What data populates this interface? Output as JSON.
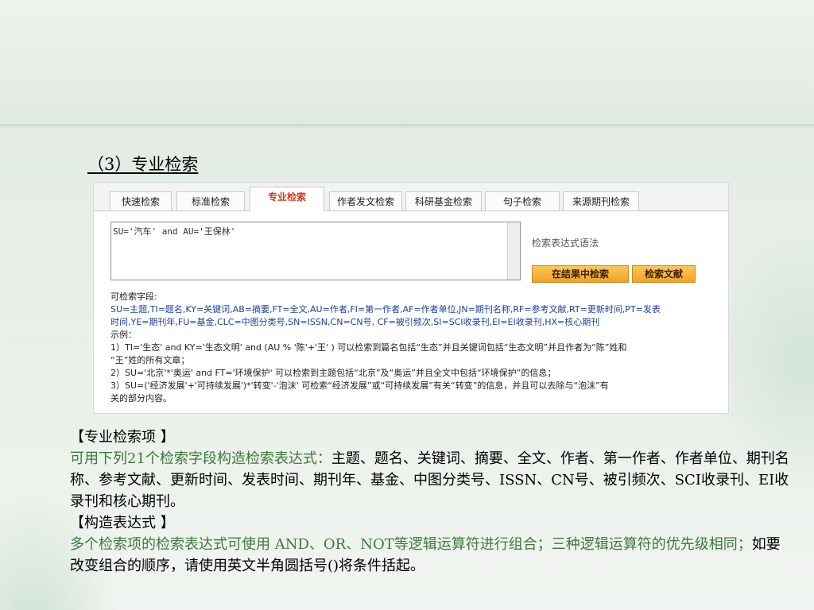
{
  "section_title": "（3）专业检索",
  "tabs": [
    "快速检索",
    "标准检索",
    "专业检索",
    "作者发文检索",
    "科研基金检索",
    "句子检索",
    "来源期刊检索"
  ],
  "expression_value": "SU='汽车' and AU='王保林'",
  "syntax_link": "检索表达式语法",
  "buttons": {
    "search_in_results": "在结果中检索",
    "search_documents": "检索文献"
  },
  "fields": {
    "label": "可检索字段:",
    "line1": "SU=主题,TI=题名,KY=关键词,AB=摘要,FT=全文,AU=作者,FI=第一作者,AF=作者单位,JN=期刊名称,RF=参考文献,RT=更新时间,PT=发表",
    "line2": "时间,YE=期刊年,FU=基金,CLC=中图分类号,SN=ISSN,CN=CN号, CF=被引频次,SI=SCI收录刊,EI=EI收录刊,HX=核心期刊",
    "examples_label": "示例：",
    "ex1a": "1）TI='生态' and KY='生态文明' and (AU % '陈'+'王' ) 可以检索到篇名包括“生态”并且关键词包括“生态文明”并且作者为“陈”姓和",
    "ex1b": "“王”姓的所有文章；",
    "ex2": "2）SU='北京'*'奥运' and FT='环境保护' 可以检索到主题包括“北京”及“奥运”并且全文中包括“环境保护”的信息；",
    "ex3a": "3）SU=('经济发展'+'可持续发展')*'转变'-'泡沫' 可检索“经济发展”或“可持续发展”有关“转变”的信息，并且可以去除与“泡沫”有",
    "ex3b": "关的部分内容。"
  },
  "notes": {
    "heading1": "【专业检索项 】",
    "para1_green": "可用下列21个检索字段构造检索表达式：",
    "para1_rest": "主题、题名、关键词、摘要、全文、作者、第一作者、作者单位、期刊名称、参考文献、更新时间、发表时间、期刊年、基金、中图分类号、ISSN、CN号、被引频次、SCI收录刊、EI收录刊和核心期刊。",
    "heading2": "【构造表达式 】",
    "para2_green": "多个检索项的检索表达式可使用 AND、OR、NOT等逻辑运算符进行组合；三种逻辑运算符的优先级相同；",
    "para2_rest": "如要改变组合的顺序，请使用英文半角圆括号()将条件括起。"
  },
  "colors": {
    "active_tab_text": "#d23a1c",
    "button_fill": "#f2a126",
    "field_text": "#1c3f9e",
    "note_green": "#3a7a3a"
  }
}
